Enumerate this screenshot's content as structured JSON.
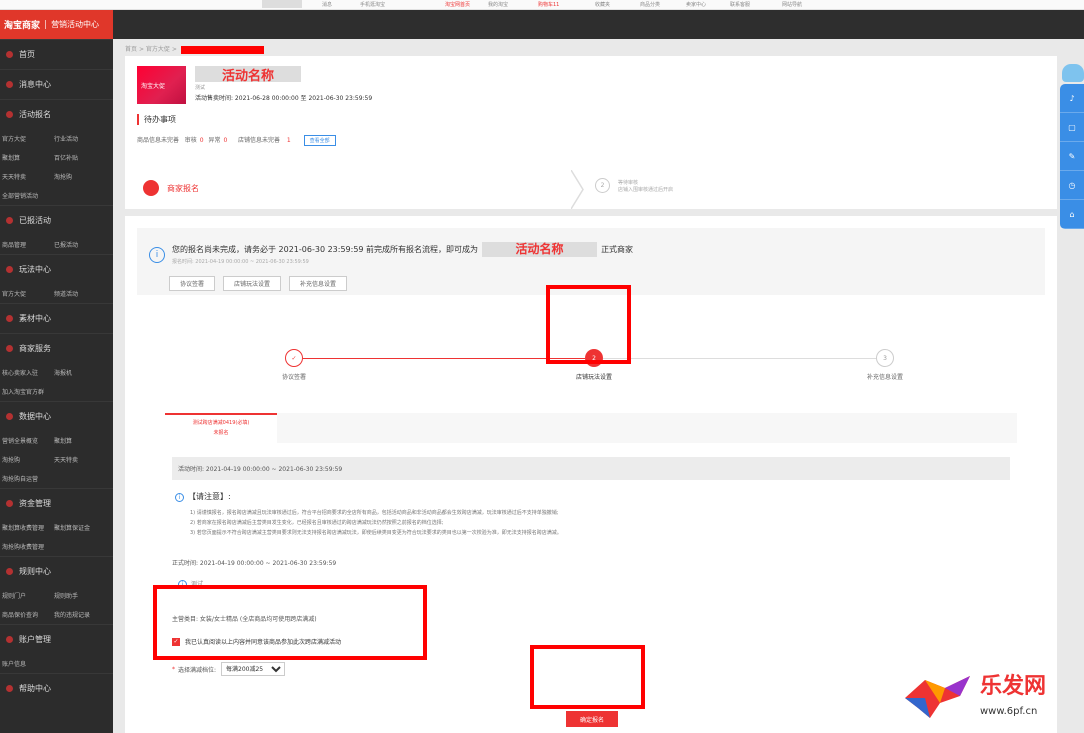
{
  "topbar": {
    "items": [
      "消息",
      "手机逛淘宝",
      "淘宝网首页",
      "我的淘宝",
      "购物车11",
      "收藏夹",
      "商品分类",
      "卖家中心",
      "联系客服",
      "网站导航"
    ]
  },
  "sidebar": {
    "brand": "淘宝商家",
    "brand_sub": "营销活动中心",
    "sections": [
      {
        "label": "首页",
        "rows": []
      },
      {
        "label": "消息中心",
        "rows": []
      },
      {
        "label": "活动报名",
        "rows": [
          [
            "官方大促",
            "行业活动"
          ],
          [
            "聚划算",
            "百亿补贴"
          ],
          [
            "天天特卖",
            "淘抢购"
          ],
          [
            "全部营销活动"
          ]
        ]
      },
      {
        "label": "已报活动",
        "rows": [
          [
            "商品管理",
            "已报活动"
          ]
        ]
      },
      {
        "label": "玩法中心",
        "rows": [
          [
            "官方大促",
            "频道活动"
          ]
        ]
      },
      {
        "label": "素材中心",
        "rows": []
      },
      {
        "label": "商家服务",
        "rows": [
          [
            "核心卖家入驻",
            "海报机"
          ],
          [
            "加入淘宝官方群"
          ]
        ]
      },
      {
        "label": "数据中心",
        "rows": [
          [
            "营销全景概览",
            "聚划算"
          ],
          [
            "淘抢购",
            "天天特卖"
          ],
          [
            "淘抢购自运营"
          ]
        ]
      },
      {
        "label": "资金管理",
        "rows": [
          [
            "聚划算收费管理",
            "聚划算保证金"
          ],
          [
            "淘抢购收费管理"
          ]
        ]
      },
      {
        "label": "规则中心",
        "rows": [
          [
            "规则门户",
            "规则助手"
          ],
          [
            "商品保价查询",
            "我的违规记录"
          ]
        ]
      },
      {
        "label": "账户管理",
        "rows": [
          [
            "账户信息"
          ]
        ]
      },
      {
        "label": "帮助中心",
        "rows": []
      }
    ]
  },
  "breadcrumb": {
    "home": "首页",
    "sep": ">",
    "level1": "官方大促"
  },
  "activity": {
    "logo_text": "淘宝大促",
    "name": "活动名称",
    "tag": "测试",
    "reg_time": "活动售卖时间: 2021-06-28 00:00:00 至 2021-06-30 23:59:59"
  },
  "todo": {
    "title": "待办事项",
    "goods_label": "商品信息未完善",
    "audit_label": "审核",
    "audit_count": "0",
    "abnormal_label": "异常",
    "abnormal_count": "0",
    "shop_label": "店铺信息未完善",
    "shop_count": "1",
    "view_all": "查看全部"
  },
  "steps": {
    "current": "商家报名",
    "next_num": "2",
    "next_title": "等待审核",
    "next_desc": "店铺入围审核通过后开启"
  },
  "notice": {
    "icon": "i",
    "prefix": "您的报名尚未完成，请务必于 2021-06-30 23:59:59 前完成所有报名流程，即可成为",
    "activity_name": "活动名称",
    "suffix": "正式商家",
    "time": "报名时间: 2021-04-19 00:00:00 ~ 2021-06-30 23:59:59",
    "buttons": [
      "协议签署",
      "店铺玩法设置",
      "补充信息设置"
    ]
  },
  "progress": [
    {
      "num": "✓",
      "label": "协议签署",
      "state": "done"
    },
    {
      "num": "2",
      "label": "店铺玩法设置",
      "state": "current"
    },
    {
      "num": "3",
      "label": "补充信息设置",
      "state": "todo"
    }
  ],
  "tab": {
    "title": "测试跨店满减0419(必填)",
    "status": "未报名"
  },
  "activity_time": "活动时间: 2021-04-19 00:00:00 ~ 2021-06-30 23:59:59",
  "attention": {
    "title": "【请注意】:",
    "rules": [
      "1) 请谨慎报名，报名跨店满减且玩法审核通过后，符合平台招商要求的全店所有商品，包括活动商品和非活动商品都会生效跨店满减，玩法审核通过后不支持单独撤销;",
      "2) 若商家在报名跨店满减后主营类目发生变化，已经报名且审核通过的跨店满减玩法仍然按照之前报名的档位选择;",
      "3) 若您页面提示不符合跨店满减主营类目要求则无法支持报名跨店满减玩法，即使后续类目变更为符合玩法要求的类目也以第一次校验为准，即无法支持报名跨店满减。"
    ]
  },
  "formal_time": "正式时间: 2021-04-19 00:00:00 ~ 2021-06-30 23:59:59",
  "test_note": "测试",
  "category": "主营类目: 女装/女士精品 (全店商品均可使用跨店满减)",
  "agree_text": "我已认真阅读以上内容并同意该商品参加此次跨店满减活动",
  "tier": {
    "label": "选择满减档位:",
    "required": "*",
    "value": "每满200减25"
  },
  "confirm_button": "确定报名",
  "watermark": {
    "cn": "乐发网",
    "url": "www.6pf.cn"
  },
  "colors": {
    "accent": "#e33333",
    "sidebar": "#2c2c2c",
    "link": "#3a8ee6"
  }
}
